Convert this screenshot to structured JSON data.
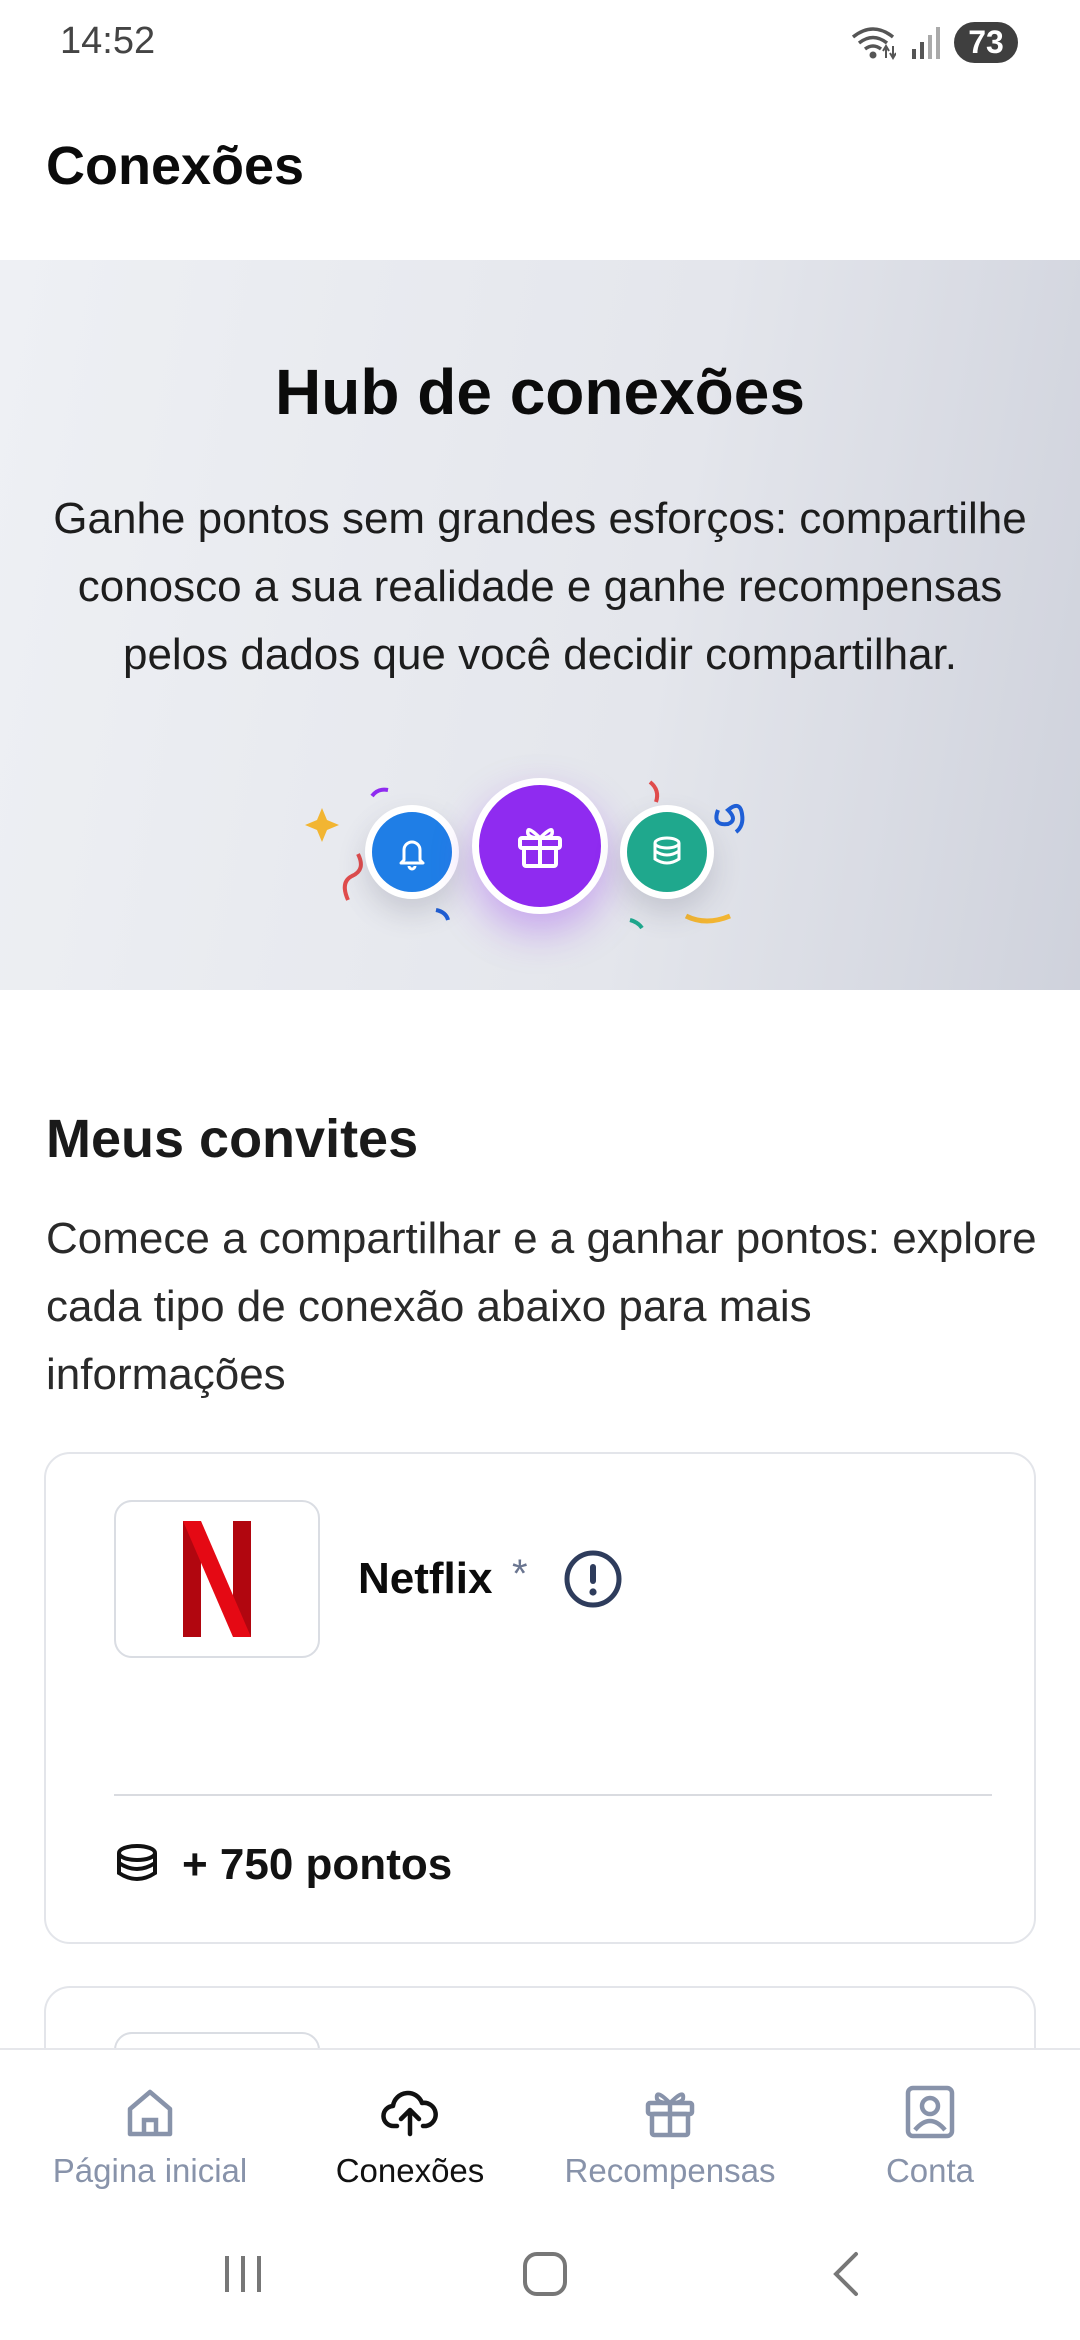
{
  "status_bar": {
    "time": "14:52",
    "battery": "73"
  },
  "header": {
    "title": "Conexões"
  },
  "hero": {
    "title": "Hub de conexões",
    "description": "Ganhe pontos sem grandes esforços: compartilhe conosco a sua realidade e ganhe recompensas pelos dados que você decidir compartilhar.",
    "icons": [
      "bell-icon",
      "gift-icon",
      "coins-icon"
    ]
  },
  "invites": {
    "title": "Meus convites",
    "description": "Comece a compartilhar e a ganhar pontos: explore cada tipo de conexão abaixo para mais informações",
    "cards": [
      {
        "name": "Netflix",
        "asterisk": "*",
        "points": "+ 750 pontos",
        "logo": "netflix-logo"
      }
    ]
  },
  "bottom_nav": {
    "items": [
      {
        "label": "Página inicial",
        "icon": "home-icon",
        "active": false
      },
      {
        "label": "Conexões",
        "icon": "cloud-upload-icon",
        "active": true
      },
      {
        "label": "Recompensas",
        "icon": "gift-icon",
        "active": false
      },
      {
        "label": "Conta",
        "icon": "account-icon",
        "active": false
      }
    ]
  },
  "colors": {
    "accent_purple": "#8f2bf0",
    "blue": "#1f7ee6",
    "green": "#1fa88d",
    "netflix_red": "#e50914",
    "nav_inactive": "#8893aa"
  }
}
